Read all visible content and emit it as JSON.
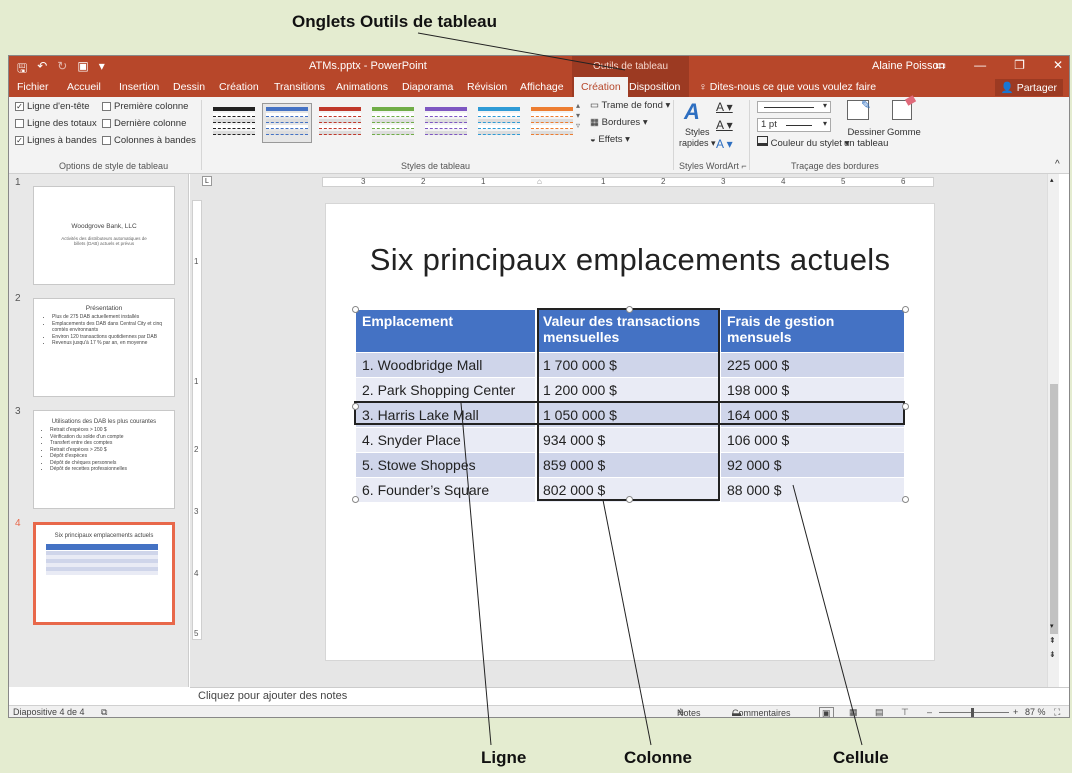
{
  "callouts": {
    "top": "Onglets Outils de tableau",
    "row": "Ligne",
    "column": "Colonne",
    "cell": "Cellule"
  },
  "window": {
    "title": "ATMs.pptx - PowerPoint",
    "context_label": "Outils de tableau",
    "user": "Alaine Poisson"
  },
  "tabs": [
    "Fichier",
    "Accueil",
    "Insertion",
    "Dessin",
    "Création",
    "Transitions",
    "Animations",
    "Diaporama",
    "Révision",
    "Affichage",
    "Création",
    "Disposition"
  ],
  "tell_me": "Dites-nous ce que vous voulez faire",
  "share": "Partager",
  "ribbon": {
    "options": {
      "header_row": "Ligne d'en-tête",
      "first_column": "Première colonne",
      "total_row": "Ligne des totaux",
      "last_column": "Dernière colonne",
      "banded_rows": "Lignes à bandes",
      "banded_columns": "Colonnes à bandes",
      "group_label": "Options de style de tableau"
    },
    "styles": {
      "group_label": "Styles de tableau",
      "shading": "Trame de fond",
      "borders": "Bordures",
      "effects": "Effets",
      "colors": [
        "#222222",
        "#4472c4",
        "#c0392b",
        "#70ad47",
        "#7e57c2",
        "#2e9bd6",
        "#ed7d31"
      ]
    },
    "wordart": {
      "quick_styles_1": "Styles",
      "quick_styles_2": "rapides",
      "group_label": "Styles WordArt"
    },
    "borders": {
      "weight": "1 pt",
      "pen_color": "Couleur du stylet",
      "draw_table_1": "Dessiner",
      "draw_table_2": "un tableau",
      "eraser": "Gomme",
      "group_label": "Traçage des bordures"
    }
  },
  "thumbnails": [
    {
      "num": "1",
      "title": "Woodgrove Bank, LLC",
      "subtitle": "Activités des distributeurs automatiques de billets (DAB) actuels et prévus",
      "bullets": []
    },
    {
      "num": "2",
      "title": "Présentation",
      "subtitle": "",
      "bullets": [
        "Plus de 275 DAB actuellement installés",
        "Emplacements des DAB dans Central City et cinq comtés environnants",
        "Environ 120 transactions quotidiennes par DAB",
        "Revenus jusqu'à 17 % par an, en moyenne"
      ]
    },
    {
      "num": "3",
      "title": "Utilisations des DAB les plus courantes",
      "subtitle": "",
      "bullets": [
        "Retrait d'espèces > 100 $",
        "Vérification du solde d'un compte",
        "Transfert entre des comptes",
        "Retrait d'espèces > 250 $",
        "Dépôt d'espèces",
        "Dépôt de chèques personnels",
        "Dépôt de recettes professionnelles"
      ]
    },
    {
      "num": "4",
      "title": "Six principaux emplacements actuels",
      "subtitle": "",
      "bullets": []
    }
  ],
  "slide": {
    "title": "Six principaux emplacements actuels",
    "headers": [
      "Emplacement",
      "Valeur des transactions mensuelles",
      "Frais de gestion mensuels"
    ],
    "rows": [
      [
        "1. Woodbridge Mall",
        "1 700 000 $",
        "225 000 $"
      ],
      [
        "2. Park Shopping Center",
        "1 200 000 $",
        "198 000 $"
      ],
      [
        "3. Harris Lake Mall",
        "1 050 000 $",
        "164 000 $"
      ],
      [
        "4. Snyder Place",
        "934 000 $",
        "106 000 $"
      ],
      [
        "5. Stowe Shoppes",
        "859 000 $",
        "92 000 $"
      ],
      [
        "6. Founder’s Square",
        "802 000 $",
        "88 000 $"
      ]
    ]
  },
  "notes_placeholder": "Cliquez pour ajouter des notes",
  "status": {
    "slide_info": "Diapositive 4 de 4",
    "notes": "Notes",
    "comments": "Commentaires",
    "zoom": "87 %"
  }
}
